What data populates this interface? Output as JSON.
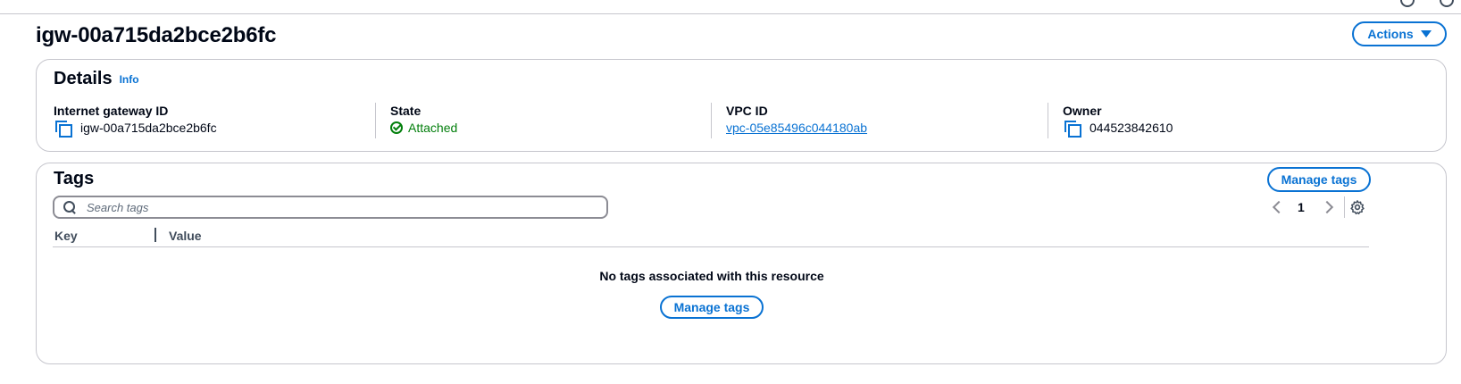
{
  "page": {
    "title": "igw-00a715da2bce2b6fc",
    "actions_label": "Actions"
  },
  "details": {
    "heading": "Details",
    "info_label": "Info",
    "fields": [
      {
        "label": "Internet gateway ID",
        "value": "igw-00a715da2bce2b6fc",
        "icon": "copy-icon"
      },
      {
        "label": "State",
        "value": "Attached",
        "icon": "check-circle-icon",
        "color": "#037f0c"
      },
      {
        "label": "VPC ID",
        "value": "vpc-05e85496c044180ab",
        "link": true
      },
      {
        "label": "Owner",
        "value": "044523842610",
        "icon": "copy-icon"
      }
    ]
  },
  "tags": {
    "heading": "Tags",
    "manage_label": "Manage tags",
    "search_placeholder": "Search tags",
    "page_number": "1",
    "columns": [
      "Key",
      "Value"
    ],
    "empty_message": "No tags associated with this resource",
    "empty_manage_label": "Manage tags"
  },
  "colors": {
    "accent": "#0972d3",
    "success": "#037f0c",
    "border": "#c6c6cd",
    "text": "#000716"
  }
}
